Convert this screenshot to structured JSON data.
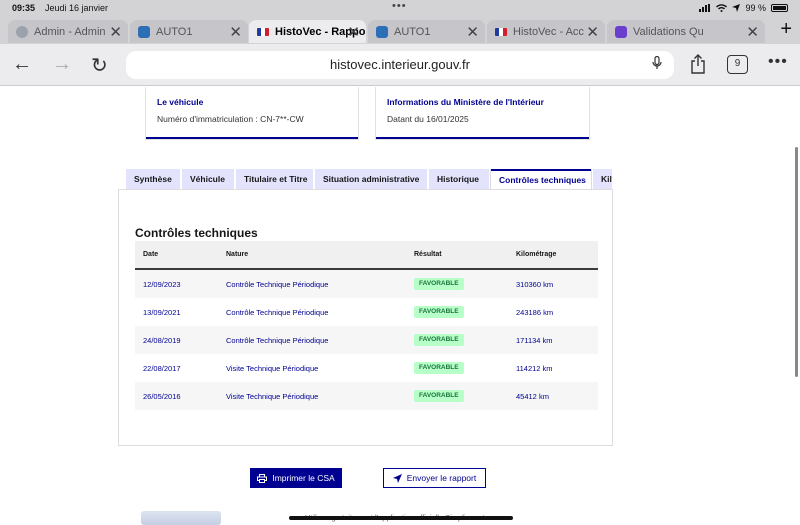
{
  "status": {
    "time": "09:35",
    "date": "Jeudi 16 janvier",
    "battery": "99 %"
  },
  "browser_tabs": [
    {
      "title": "Admin - Admin",
      "icon": "globe-icon",
      "active": false
    },
    {
      "title": "AUTO1",
      "icon": "auto1-icon",
      "active": false
    },
    {
      "title": "HistoVec - Rapport",
      "icon": "flag-fr-icon",
      "active": true
    },
    {
      "title": "AUTO1",
      "icon": "auto1-icon",
      "active": false
    },
    {
      "title": "HistoVec - Acc",
      "icon": "flag-fr-icon",
      "active": false
    },
    {
      "title": "Validations Qu",
      "icon": "list-icon",
      "active": false
    }
  ],
  "address": {
    "url": "histovec.interieur.gouv.fr",
    "tab_count": "9"
  },
  "cards": {
    "vehicle": {
      "heading": "Le véhicule",
      "text": "Numéro d'immatriculation : CN-7**-CW"
    },
    "ministry": {
      "heading": "Informations du Ministère de l'Intérieur",
      "text": "Datant du 16/01/2025"
    }
  },
  "page_tabs": [
    {
      "label": "Synthèse",
      "active": false
    },
    {
      "label": "Véhicule",
      "active": false
    },
    {
      "label": "Titulaire et Titre",
      "active": false
    },
    {
      "label": "Situation administrative",
      "active": false
    },
    {
      "label": "Historique",
      "active": false
    },
    {
      "label": "Contrôles techniques",
      "active": true
    },
    {
      "label": "Kilométrage",
      "active": false
    }
  ],
  "section_title": "Contrôles techniques",
  "table": {
    "headers": [
      "Date",
      "Nature",
      "Résultat",
      "Kilométrage"
    ],
    "rows": [
      {
        "date": "12/09/2023",
        "nature": "Contrôle Technique Périodique",
        "result": "FAVORABLE",
        "km": "310360 km"
      },
      {
        "date": "13/09/2021",
        "nature": "Contrôle Technique Périodique",
        "result": "FAVORABLE",
        "km": "243186 km"
      },
      {
        "date": "24/08/2019",
        "nature": "Contrôle Technique Périodique",
        "result": "FAVORABLE",
        "km": "171134 km"
      },
      {
        "date": "22/08/2017",
        "nature": "Visite Technique Périodique",
        "result": "FAVORABLE",
        "km": "114212 km"
      },
      {
        "date": "26/05/2016",
        "nature": "Visite Technique Périodique",
        "result": "FAVORABLE",
        "km": "45412 km"
      }
    ]
  },
  "buttons": {
    "print": "Imprimer le CSA",
    "send": "Envoyer le rapport"
  },
  "bottom_text": "Utilisez gratuitement l'application officielle Simplimmat"
}
